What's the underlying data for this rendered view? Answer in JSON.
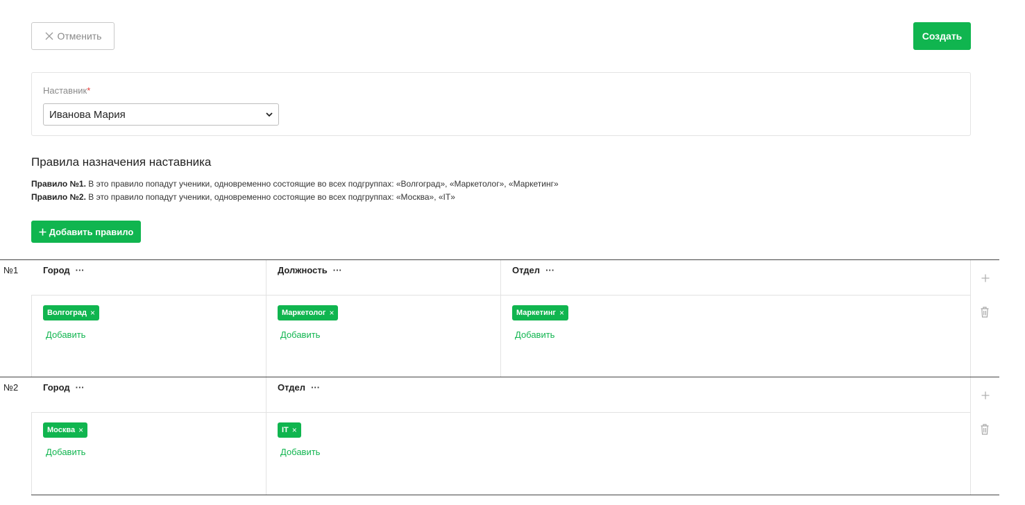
{
  "toolbar": {
    "cancel_label": "Отменить",
    "create_label": "Создать"
  },
  "mentor": {
    "label": "Наставник",
    "required_mark": "*",
    "selected": "Иванова Мария"
  },
  "rules_section": {
    "title": "Правила назначения наставника",
    "rule_descriptions": [
      {
        "prefix": "Правило №1.",
        "text": " В это правило попадут ученики, одновременно состоящие во всех подгруппах: «Волгоград», «Маркетолог», «Маркетинг»"
      },
      {
        "prefix": "Правило №2.",
        "text": " В это правило попадут ученики, одновременно состоящие во всех подгруппах: «Москва», «IT»"
      }
    ],
    "add_rule_label": "Добавить правило"
  },
  "rules": [
    {
      "number": "№1",
      "columns": [
        {
          "header": "Город",
          "dots": "···",
          "tag": "Волгоград",
          "tag_close": "×",
          "add_label": "Добавить"
        },
        {
          "header": "Должность",
          "dots": "···",
          "tag": "Маркетолог",
          "tag_close": "×",
          "add_label": "Добавить"
        },
        {
          "header": "Отдел",
          "dots": "···",
          "tag": "Маркетинг",
          "tag_close": "×",
          "add_label": "Добавить"
        }
      ]
    },
    {
      "number": "№2",
      "columns": [
        {
          "header": "Город",
          "dots": "···",
          "tag": "Москва",
          "tag_close": "×",
          "add_label": "Добавить"
        },
        {
          "header": "Отдел",
          "dots": "···",
          "tag": "IT",
          "tag_close": "×",
          "add_label": "Добавить"
        }
      ]
    }
  ],
  "icons": {
    "cancel": "close-icon",
    "select": "chevron-down-icon",
    "add_rule": "plus-icon",
    "row_add": "plus-icon",
    "row_delete": "trash-icon"
  },
  "colors": {
    "accent": "#10b54f",
    "danger": "#e53935"
  }
}
